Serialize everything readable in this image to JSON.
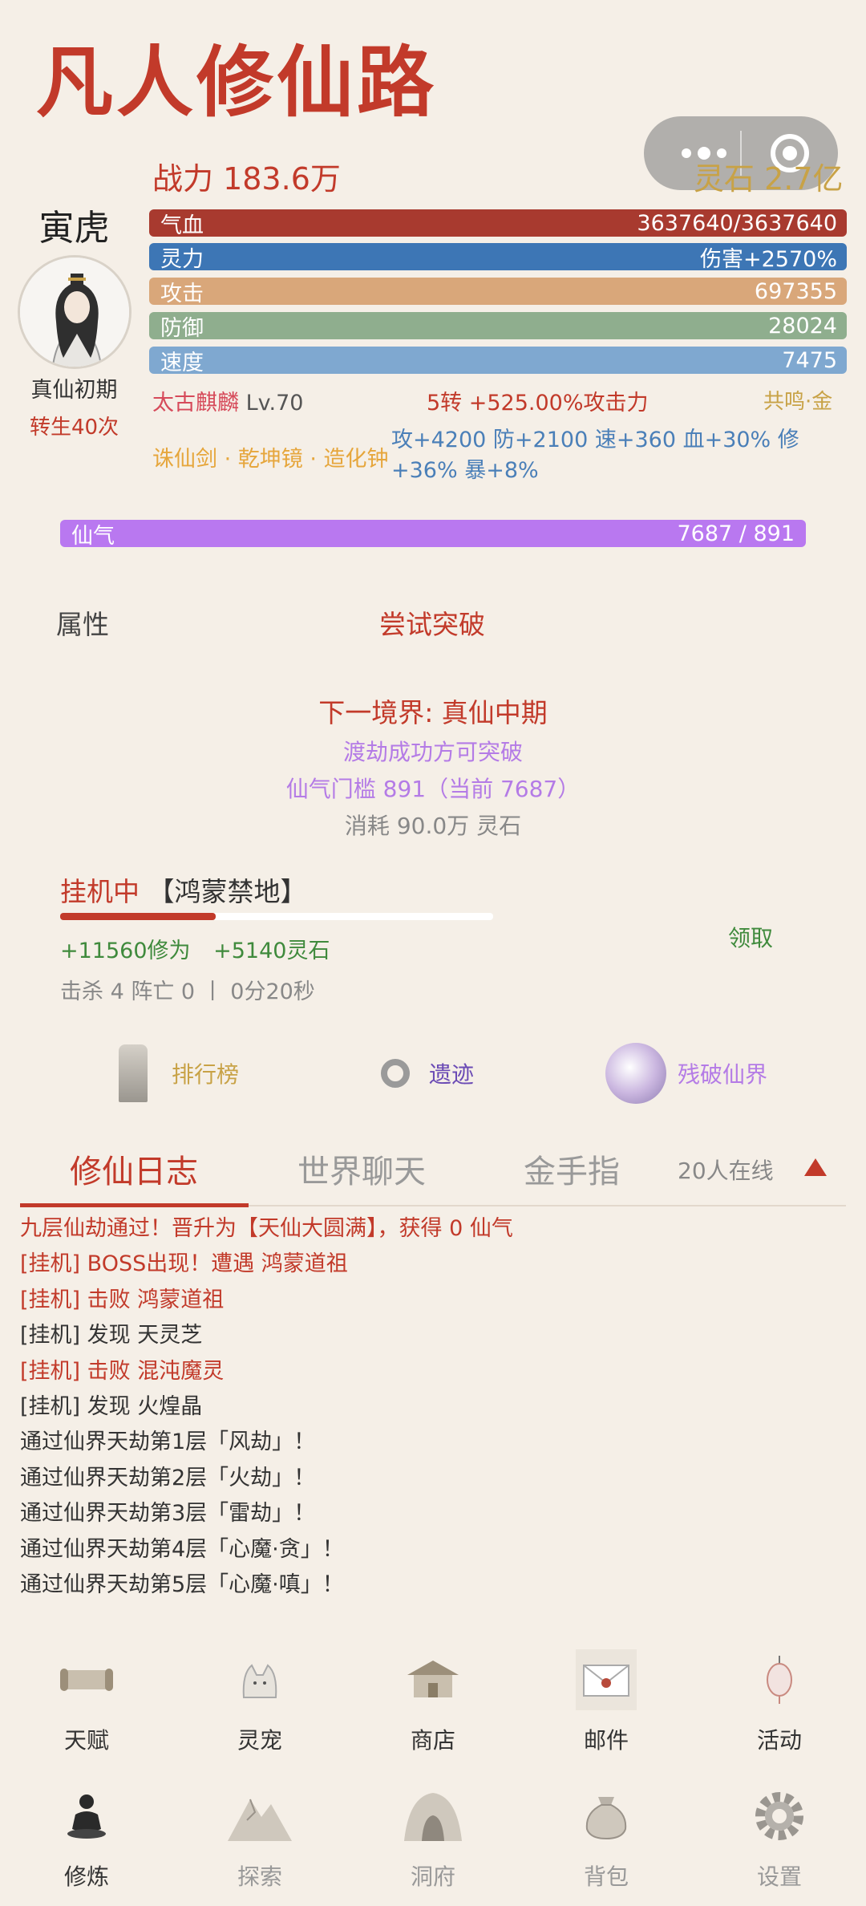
{
  "app_title": "凡人修仙路",
  "header": {
    "combat_power": "战力 183.6万",
    "spirit_stone": "灵石 2.7亿"
  },
  "character": {
    "name": "寅虎",
    "realm": "真仙初期",
    "rebirth": "转生40次"
  },
  "bars": {
    "hp": {
      "label": "气血",
      "value": "3637640/3637640"
    },
    "mp": {
      "label": "灵力",
      "value": "伤害+2570%"
    },
    "atk": {
      "label": "攻击",
      "value": "697355"
    },
    "def": {
      "label": "防御",
      "value": "28024"
    },
    "spd": {
      "label": "速度",
      "value": "7475"
    }
  },
  "pet": {
    "name": "太古麒麟",
    "level": "Lv.70"
  },
  "turn_bonus": "5转 +525.00%攻击力",
  "resonance": "共鸣·金",
  "artifacts": "诛仙剑 · 乾坤镜 · 造化钟",
  "artifact_bonus": "攻+4200 防+2100 速+360 血+30% 修+36% 暴+8%",
  "qi": {
    "label": "仙气",
    "value": "7687 / 891"
  },
  "actions": {
    "attributes": "属性",
    "try_breakthrough": "尝试突破"
  },
  "breakthrough": {
    "next_realm": "下一境界: 真仙中期",
    "tribulation": "渡劫成功方可突破",
    "threshold": "仙气门槛 891（当前 7687）",
    "cost": "消耗 90.0万 灵石"
  },
  "idle": {
    "status": "挂机中",
    "location": "【鸿蒙禁地】",
    "progress_fraction": 0.36,
    "gain_cultivation": "+11560修为",
    "gain_stone": "+5140灵石",
    "collect": "领取",
    "stats": "击杀 4  阵亡 0 丨 0分20秒"
  },
  "entries": {
    "ranking": "排行榜",
    "ruins": "遗迹",
    "broken_realm": "残破仙界"
  },
  "tabs": {
    "log": "修仙日志",
    "chat": "世界聊天",
    "cheat": "金手指",
    "online": "20人在线"
  },
  "log_lines": [
    {
      "text": "九层仙劫通过！晋升为【天仙大圆满】，获得 0 仙气",
      "color": "#c23a2a"
    },
    {
      "text": "[挂机] BOSS出现！遭遇 鸿蒙道祖",
      "color": "#c23a2a"
    },
    {
      "text": "[挂机] 击败 鸿蒙道祖",
      "color": "#c23a2a"
    },
    {
      "text": "[挂机] 发现 天灵芝",
      "color": "#333333"
    },
    {
      "text": "[挂机] 击败 混沌魔灵",
      "color": "#c23a2a"
    },
    {
      "text": "[挂机] 发现 火煌晶",
      "color": "#333333"
    },
    {
      "text": "通过仙界天劫第1层「风劫」！",
      "color": "#333333"
    },
    {
      "text": "通过仙界天劫第2层「火劫」！",
      "color": "#333333"
    },
    {
      "text": "通过仙界天劫第3层「雷劫」！",
      "color": "#333333"
    },
    {
      "text": "通过仙界天劫第4层「心魔·贪」！",
      "color": "#333333"
    },
    {
      "text": "通过仙界天劫第5层「心魔·嗔」！",
      "color": "#333333"
    }
  ],
  "grid_row1": [
    "天赋",
    "灵宠",
    "商店",
    "邮件",
    "活动"
  ],
  "grid_row2": [
    "修炼",
    "探索",
    "洞府",
    "背包",
    "设置"
  ],
  "colors": {
    "accent_red": "#c23a2a",
    "gold": "#c8a246",
    "purple": "#b978f0",
    "green": "#3f8a3c",
    "background": "#f5efe7"
  }
}
